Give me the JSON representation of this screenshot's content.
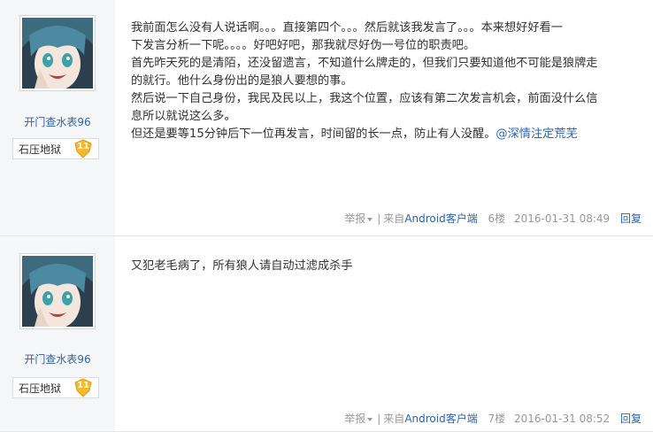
{
  "posts": [
    {
      "username": "开门查水表96",
      "badge_text": "石压地狱",
      "level": "11",
      "lines": [
        "我前面怎么没有人说话啊。。。直接第四个。。。然后就该我发言了。。。本来想好好看一",
        "下发言分析一下呢。。。。好吧好吧，那我就尽好伪一号位的职责吧。",
        "首先昨天死的是清陌，还没留遗言，不知道什么牌走的，但我们只要知道他不可能是狼牌走",
        "的就行。他什么身份出的是狼人要想的事。",
        "然后说一下自己身份，我民及民以上，我这个位置，应该有第二次发言机会，前面没什么信",
        "息所以就说这么多。"
      ],
      "last_line": "但还是要等15分钟后下一位再发言，时间留的长一点，防止有人没醒。",
      "mention": "@深情注定荒芜",
      "report": "举报",
      "source_prefix": "来自",
      "source_link": "Android客户端",
      "floor": "6楼",
      "time": "2016-01-31 08:49",
      "reply": "回复"
    },
    {
      "username": "开门查水表96",
      "badge_text": "石压地狱",
      "level": "11",
      "lines": [
        "又犯老毛病了，所有狼人请自动过滤成杀手"
      ],
      "report": "举报",
      "source_prefix": "来自",
      "source_link": "Android客户端",
      "floor": "7楼",
      "time": "2016-01-31 08:52",
      "reply": "回复"
    }
  ],
  "colors": {
    "link": "#2d64b3",
    "sidebar_bg": "#f5f6f8",
    "badge": "#f5b82e"
  }
}
